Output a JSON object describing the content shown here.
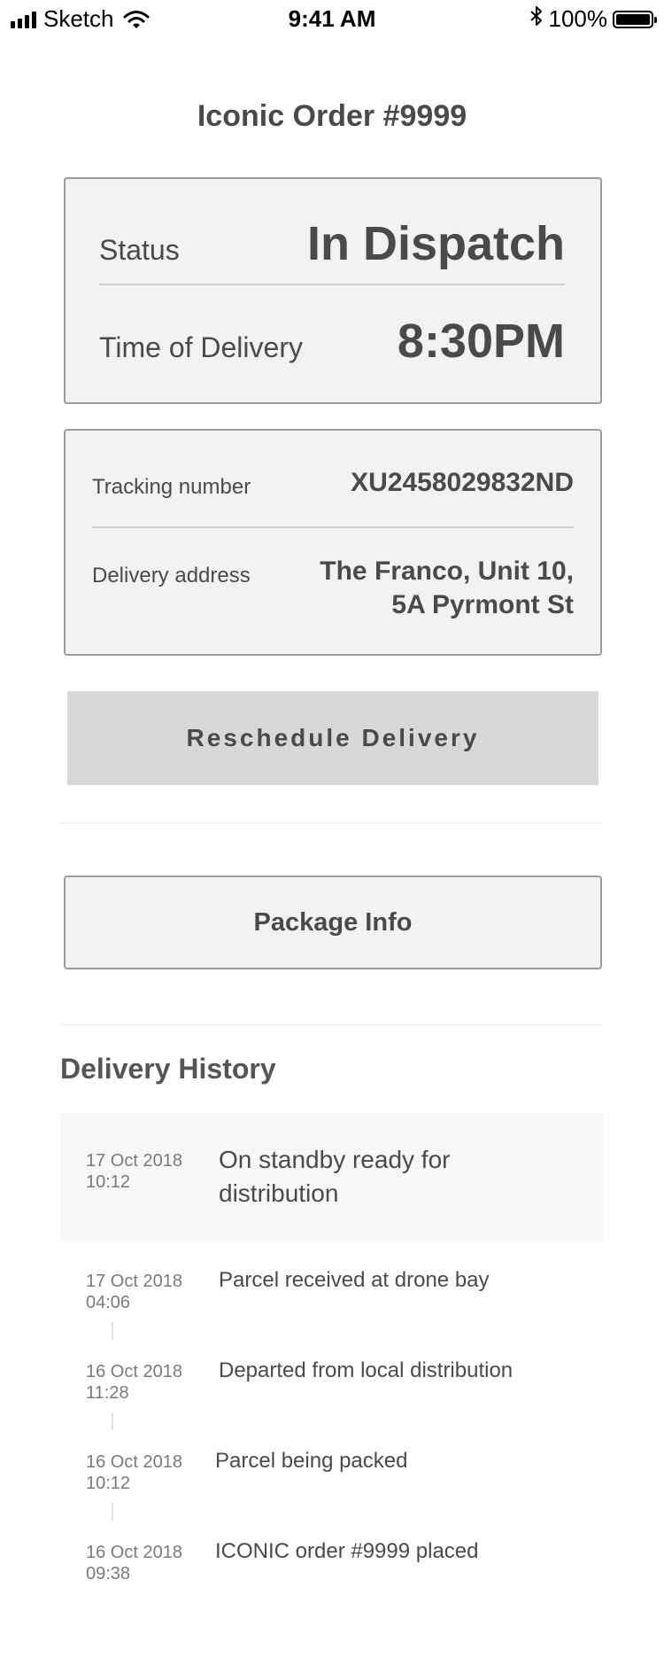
{
  "status_bar": {
    "carrier": "Sketch",
    "time": "9:41 AM",
    "battery": "100%",
    "icons": [
      "signal-icon",
      "wifi-icon",
      "bluetooth-icon",
      "battery-icon"
    ]
  },
  "page": {
    "title": "Iconic Order #9999"
  },
  "status_card": {
    "status_label": "Status",
    "status_value": "In Dispatch",
    "time_label": "Time of Delivery",
    "time_value": "8:30PM"
  },
  "tracking_card": {
    "tracking_label": "Tracking number",
    "tracking_value": "XU2458029832ND",
    "address_label": "Delivery address",
    "address_line1": "The Franco, Unit 10,",
    "address_line2": "5A Pyrmont St"
  },
  "actions": {
    "reschedule_label": "Reschedule Delivery",
    "package_info_label": "Package Info"
  },
  "history": {
    "title": "Delivery History",
    "items": [
      {
        "date": "17 Oct 2018",
        "time": "10:12",
        "text_line1": "On standby ready for",
        "text_line2": "distribution",
        "active": true
      },
      {
        "date": "17 Oct 2018",
        "time": "04:06",
        "text": "Parcel received at drone bay"
      },
      {
        "date": "16 Oct 2018",
        "time": "11:28",
        "text": "Departed from local distribution"
      },
      {
        "date": "16 Oct 2018",
        "time": "10:12",
        "text": "Parcel being packed"
      },
      {
        "date": "16 Oct 2018",
        "time": "09:38",
        "text": "ICONIC order #9999 placed"
      }
    ]
  }
}
